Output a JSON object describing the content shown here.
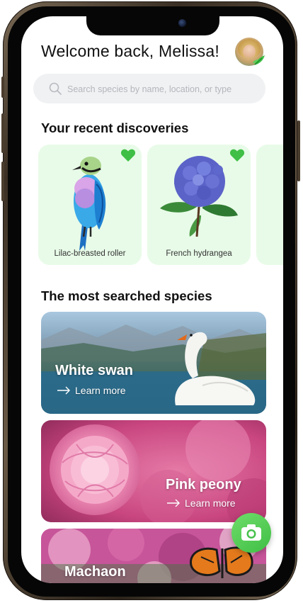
{
  "header": {
    "welcome": "Welcome back, Melissa!"
  },
  "search": {
    "placeholder": "Search species by name, location, or type",
    "value": ""
  },
  "recent": {
    "title": "Your recent discoveries",
    "cards": [
      {
        "label": "Lilac-breasted roller",
        "icon": "heart-icon",
        "favorited": true
      },
      {
        "label": "French hydrangea",
        "icon": "heart-icon",
        "favorited": true
      }
    ]
  },
  "popular": {
    "title": "The most searched species",
    "cards": [
      {
        "name": "White swan",
        "learn_more": "Learn more"
      },
      {
        "name": "Pink peony",
        "learn_more": "Learn more"
      },
      {
        "name": "Machaon",
        "learn_more": ""
      }
    ]
  },
  "colors": {
    "accent_green": "#3fbf45",
    "card_mint": "#e8fbe8",
    "search_bg": "#f0f1f3"
  },
  "icons": {
    "search": "search-icon",
    "camera": "camera-icon",
    "arrow": "arrow-right-icon",
    "leaf": "leaf-icon"
  }
}
